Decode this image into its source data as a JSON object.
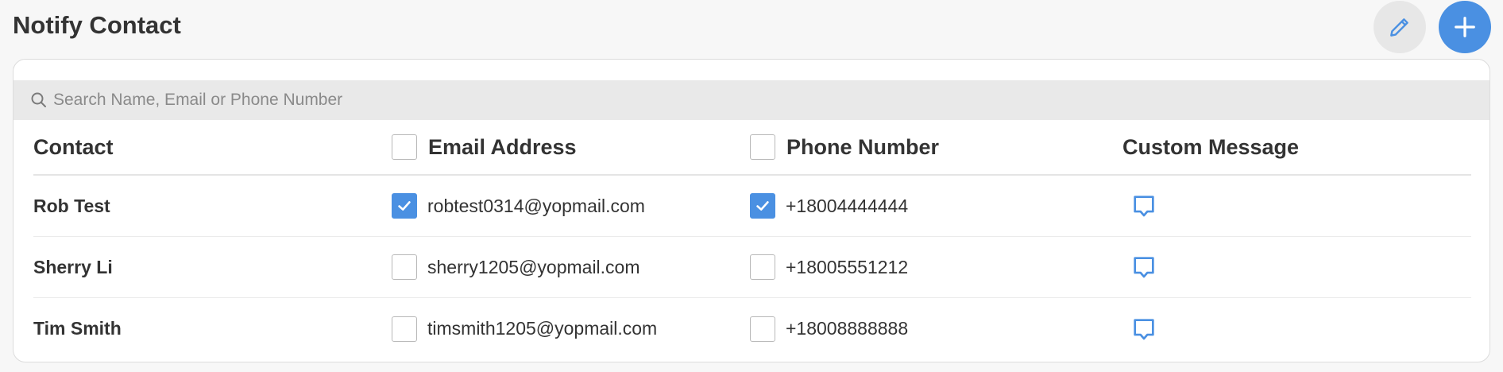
{
  "page": {
    "title": "Notify Contact",
    "edit_button": "edit",
    "add_button": "add"
  },
  "search": {
    "placeholder": "Search Name, Email or Phone Number",
    "value": ""
  },
  "table": {
    "headers": {
      "contact": "Contact",
      "email": "Email Address",
      "phone": "Phone Number",
      "message": "Custom Message"
    },
    "select_all_email": false,
    "select_all_phone": false,
    "rows": [
      {
        "name": "Rob Test",
        "email": "robtest0314@yopmail.com",
        "email_checked": true,
        "phone": "+18004444444",
        "phone_checked": true
      },
      {
        "name": "Sherry Li",
        "email": "sherry1205@yopmail.com",
        "email_checked": false,
        "phone": "+18005551212",
        "phone_checked": false
      },
      {
        "name": "Tim Smith",
        "email": "timsmith1205@yopmail.com",
        "email_checked": false,
        "phone": "+18008888888",
        "phone_checked": false
      }
    ]
  },
  "icons": {
    "edit": "pencil-icon",
    "add": "plus-icon",
    "search": "search-icon",
    "message": "speech-bubble-icon"
  },
  "colors": {
    "accent": "#4a90e2",
    "background": "#f7f7f7",
    "search_bar": "#e9e9e9",
    "text": "#333333"
  }
}
